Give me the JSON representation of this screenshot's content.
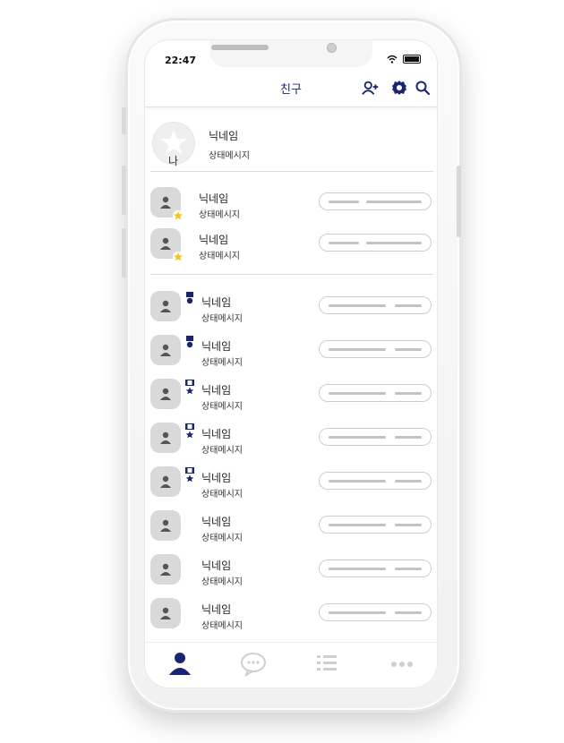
{
  "status_bar": {
    "time": "22:47"
  },
  "header": {
    "title": "친구"
  },
  "me": {
    "name": "닉네임",
    "status": "상태메시지",
    "avatar_label": "나"
  },
  "favorites": [
    {
      "name": "닉네임",
      "status": "상태메시지",
      "favorite": true
    },
    {
      "name": "닉네임",
      "status": "상태메시지",
      "favorite": true
    }
  ],
  "friends": [
    {
      "name": "닉네임",
      "status": "상태메시지",
      "badge": "medal-single"
    },
    {
      "name": "닉네임",
      "status": "상태메시지",
      "badge": "medal-single"
    },
    {
      "name": "닉네임",
      "status": "상태메시지",
      "badge": "medal-star"
    },
    {
      "name": "닉네임",
      "status": "상태메시지",
      "badge": "medal-star"
    },
    {
      "name": "닉네임",
      "status": "상태메시지",
      "badge": "medal-star"
    },
    {
      "name": "닉네임",
      "status": "상태메시지",
      "badge": ""
    },
    {
      "name": "닉네임",
      "status": "상태메시지",
      "badge": ""
    },
    {
      "name": "닉네임",
      "status": "상태메시지",
      "badge": ""
    }
  ],
  "tabs": [
    {
      "icon": "person-icon",
      "active": true
    },
    {
      "icon": "chat-bubble-icon",
      "active": false
    },
    {
      "icon": "list-icon",
      "active": false
    },
    {
      "icon": "more-dots-icon",
      "active": false
    }
  ],
  "colors": {
    "accent": "#1b2470",
    "star": "#f5c518",
    "inactive": "#cfcfcf"
  }
}
